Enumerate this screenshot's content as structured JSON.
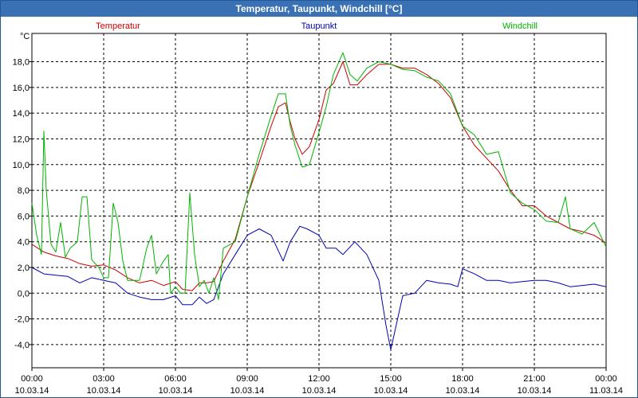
{
  "window": {
    "title": "Temperatur, Taupunkt, Windchill [°C]"
  },
  "chart_data": {
    "type": "line",
    "title": "Temperatur, Taupunkt, Windchill [°C]",
    "ylabel": "°C",
    "xlabel": "",
    "ylim": [
      -5.8,
      20.2
    ],
    "xlim": [
      0,
      24
    ],
    "grid": true,
    "legend_position": "top",
    "y_ticks": [
      -4,
      -2,
      0,
      2,
      4,
      6,
      8,
      10,
      12,
      14,
      16,
      18
    ],
    "y_tick_labels": [
      "-4,0",
      "-2,0",
      "0,0",
      "2,0",
      "4,0",
      "6,0",
      "8,0",
      "10,0",
      "12,0",
      "14,0",
      "16,0",
      "18,0"
    ],
    "x_ticks": [
      0,
      3,
      6,
      9,
      12,
      15,
      18,
      21,
      24
    ],
    "x_tick_labels": [
      [
        "00:00",
        "10.03.14"
      ],
      [
        "03:00",
        "10.03.14"
      ],
      [
        "06:00",
        "10.03.14"
      ],
      [
        "09:00",
        "10.03.14"
      ],
      [
        "12:00",
        "10.03.14"
      ],
      [
        "15:00",
        "10.03.14"
      ],
      [
        "18:00",
        "10.03.14"
      ],
      [
        "21:00",
        "10.03.14"
      ],
      [
        "00:00",
        "11.03.14"
      ]
    ],
    "series": [
      {
        "name": "Temperatur",
        "color": "#cc0000",
        "points": [
          [
            0,
            3.8
          ],
          [
            0.5,
            3.2
          ],
          [
            1,
            2.9
          ],
          [
            1.5,
            2.7
          ],
          [
            2,
            2.3
          ],
          [
            2.5,
            2.1
          ],
          [
            3,
            2.2
          ],
          [
            3.5,
            1.8
          ],
          [
            4,
            1.2
          ],
          [
            4.5,
            0.8
          ],
          [
            5,
            1.0
          ],
          [
            5.5,
            0.6
          ],
          [
            6,
            0.9
          ],
          [
            6.3,
            0.3
          ],
          [
            6.7,
            0.2
          ],
          [
            7.0,
            0.8
          ],
          [
            7.3,
            0.8
          ],
          [
            7.6,
            0.9
          ],
          [
            8.0,
            2.5
          ],
          [
            8.5,
            4.2
          ],
          [
            9,
            7.5
          ],
          [
            9.5,
            10.2
          ],
          [
            10,
            13.0
          ],
          [
            10.3,
            14.5
          ],
          [
            10.6,
            14.8
          ],
          [
            10.8,
            13.3
          ],
          [
            11.0,
            12.0
          ],
          [
            11.3,
            10.8
          ],
          [
            11.6,
            11.4
          ],
          [
            12,
            13.5
          ],
          [
            12.3,
            15.8
          ],
          [
            12.6,
            16.3
          ],
          [
            13.0,
            18.0
          ],
          [
            13.3,
            16.2
          ],
          [
            13.6,
            16.2
          ],
          [
            14,
            17.0
          ],
          [
            14.5,
            17.8
          ],
          [
            15,
            17.8
          ],
          [
            15.5,
            17.5
          ],
          [
            16,
            17.5
          ],
          [
            16.5,
            17.0
          ],
          [
            17,
            16.3
          ],
          [
            17.5,
            15.2
          ],
          [
            18,
            13.0
          ],
          [
            18.5,
            11.5
          ],
          [
            19,
            10.5
          ],
          [
            19.5,
            9.5
          ],
          [
            20,
            8.0
          ],
          [
            20.5,
            6.8
          ],
          [
            21,
            6.8
          ],
          [
            21.5,
            6.0
          ],
          [
            22,
            5.5
          ],
          [
            22.5,
            5.0
          ],
          [
            23,
            4.8
          ],
          [
            23.5,
            4.5
          ],
          [
            24,
            3.9
          ]
        ]
      },
      {
        "name": "Taupunkt",
        "color": "#0000b4",
        "points": [
          [
            0,
            2.0
          ],
          [
            0.5,
            1.5
          ],
          [
            1,
            1.4
          ],
          [
            1.5,
            1.3
          ],
          [
            2,
            0.8
          ],
          [
            2.5,
            1.2
          ],
          [
            3,
            1.0
          ],
          [
            3.5,
            0.8
          ],
          [
            4,
            0.0
          ],
          [
            4.5,
            -0.3
          ],
          [
            5,
            -0.5
          ],
          [
            5.5,
            -0.5
          ],
          [
            6,
            -0.2
          ],
          [
            6.3,
            -0.9
          ],
          [
            6.7,
            -0.9
          ],
          [
            7.0,
            -0.3
          ],
          [
            7.3,
            -0.8
          ],
          [
            7.6,
            -0.5
          ],
          [
            8.0,
            1.5
          ],
          [
            8.5,
            3.0
          ],
          [
            9,
            4.5
          ],
          [
            9.5,
            5.0
          ],
          [
            10,
            4.5
          ],
          [
            10.5,
            2.5
          ],
          [
            10.8,
            4.0
          ],
          [
            11.2,
            5.2
          ],
          [
            11.5,
            5.0
          ],
          [
            12,
            4.5
          ],
          [
            12.3,
            3.5
          ],
          [
            12.7,
            3.5
          ],
          [
            13.0,
            3.0
          ],
          [
            13.5,
            4.0
          ],
          [
            14,
            3.0
          ],
          [
            14.5,
            1.0
          ],
          [
            14.8,
            -2.5
          ],
          [
            15,
            -4.4
          ],
          [
            15.5,
            -0.2
          ],
          [
            16,
            0.0
          ],
          [
            16.5,
            1.0
          ],
          [
            17,
            0.8
          ],
          [
            17.5,
            0.7
          ],
          [
            17.8,
            0.5
          ],
          [
            18,
            1.9
          ],
          [
            18.5,
            1.5
          ],
          [
            19,
            1.0
          ],
          [
            19.5,
            1.0
          ],
          [
            20,
            0.8
          ],
          [
            20.5,
            0.9
          ],
          [
            21,
            1.0
          ],
          [
            21.5,
            1.0
          ],
          [
            22,
            0.8
          ],
          [
            22.5,
            0.5
          ],
          [
            23,
            0.6
          ],
          [
            23.5,
            0.7
          ],
          [
            24,
            0.5
          ]
        ]
      },
      {
        "name": "Windchill",
        "color": "#00b400",
        "points": [
          [
            0,
            7.0
          ],
          [
            0.2,
            4.5
          ],
          [
            0.4,
            3.0
          ],
          [
            0.5,
            12.6
          ],
          [
            0.6,
            8.0
          ],
          [
            0.8,
            3.8
          ],
          [
            1.0,
            3.2
          ],
          [
            1.2,
            5.5
          ],
          [
            1.4,
            2.8
          ],
          [
            1.6,
            3.5
          ],
          [
            1.9,
            4.0
          ],
          [
            2.1,
            7.5
          ],
          [
            2.3,
            7.5
          ],
          [
            2.5,
            2.6
          ],
          [
            2.8,
            2.0
          ],
          [
            3.0,
            1.2
          ],
          [
            3.2,
            1.2
          ],
          [
            3.4,
            7.0
          ],
          [
            3.6,
            5.5
          ],
          [
            3.8,
            2.5
          ],
          [
            4.0,
            1.0
          ],
          [
            4.5,
            1.0
          ],
          [
            4.8,
            3.5
          ],
          [
            5.0,
            4.5
          ],
          [
            5.2,
            1.5
          ],
          [
            5.5,
            2.5
          ],
          [
            5.7,
            3.0
          ],
          [
            5.8,
            0.0
          ],
          [
            6.0,
            0.5
          ],
          [
            6.2,
            0.0
          ],
          [
            6.4,
            0.0
          ],
          [
            6.6,
            7.8
          ],
          [
            6.8,
            3.0
          ],
          [
            7.0,
            0.5
          ],
          [
            7.2,
            1.0
          ],
          [
            7.4,
            0.0
          ],
          [
            7.6,
            1.2
          ],
          [
            7.8,
            -0.5
          ],
          [
            8.0,
            3.5
          ],
          [
            8.5,
            4.0
          ],
          [
            9,
            7.5
          ],
          [
            9.5,
            10.8
          ],
          [
            10,
            13.8
          ],
          [
            10.3,
            15.5
          ],
          [
            10.6,
            15.5
          ],
          [
            10.8,
            13.0
          ],
          [
            11.0,
            11.5
          ],
          [
            11.3,
            9.8
          ],
          [
            11.6,
            10.0
          ],
          [
            12,
            12.5
          ],
          [
            12.3,
            14.5
          ],
          [
            12.6,
            17.0
          ],
          [
            13.0,
            18.7
          ],
          [
            13.3,
            17.0
          ],
          [
            13.6,
            16.5
          ],
          [
            14,
            17.5
          ],
          [
            14.5,
            18.0
          ],
          [
            15,
            17.8
          ],
          [
            15.5,
            17.4
          ],
          [
            16,
            17.3
          ],
          [
            16.5,
            16.8
          ],
          [
            17,
            16.5
          ],
          [
            17.5,
            15.5
          ],
          [
            18,
            13.0
          ],
          [
            18.5,
            12.3
          ],
          [
            19,
            10.8
          ],
          [
            19.5,
            11.0
          ],
          [
            20,
            7.8
          ],
          [
            20.5,
            7.0
          ],
          [
            21,
            6.5
          ],
          [
            21.5,
            5.6
          ],
          [
            22,
            5.5
          ],
          [
            22.3,
            7.5
          ],
          [
            22.5,
            5.0
          ],
          [
            23,
            4.6
          ],
          [
            23.5,
            5.5
          ],
          [
            24,
            3.6
          ]
        ]
      }
    ]
  }
}
